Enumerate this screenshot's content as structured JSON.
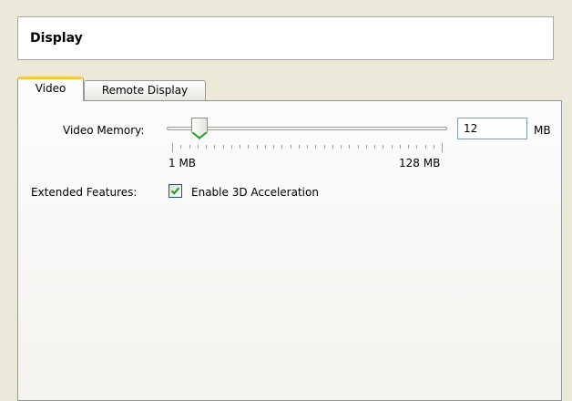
{
  "header": {
    "title": "Display"
  },
  "tabs": [
    {
      "label": "Video",
      "selected": true
    },
    {
      "label": "Remote Display",
      "selected": false
    }
  ],
  "video": {
    "memory_label": "Video Memory:",
    "memory_value": "12",
    "memory_unit": "MB",
    "slider": {
      "min": 1,
      "max": 128,
      "value": 12,
      "min_label": "1 MB",
      "max_label": "128 MB"
    },
    "extended_label": "Extended Features:",
    "accel_checkbox": {
      "label": "Enable 3D Acceleration",
      "checked": true
    }
  },
  "colors": {
    "tab_highlight": "#ffc83c",
    "check_mark": "#21a121",
    "window_bg": "#ece9d8"
  }
}
